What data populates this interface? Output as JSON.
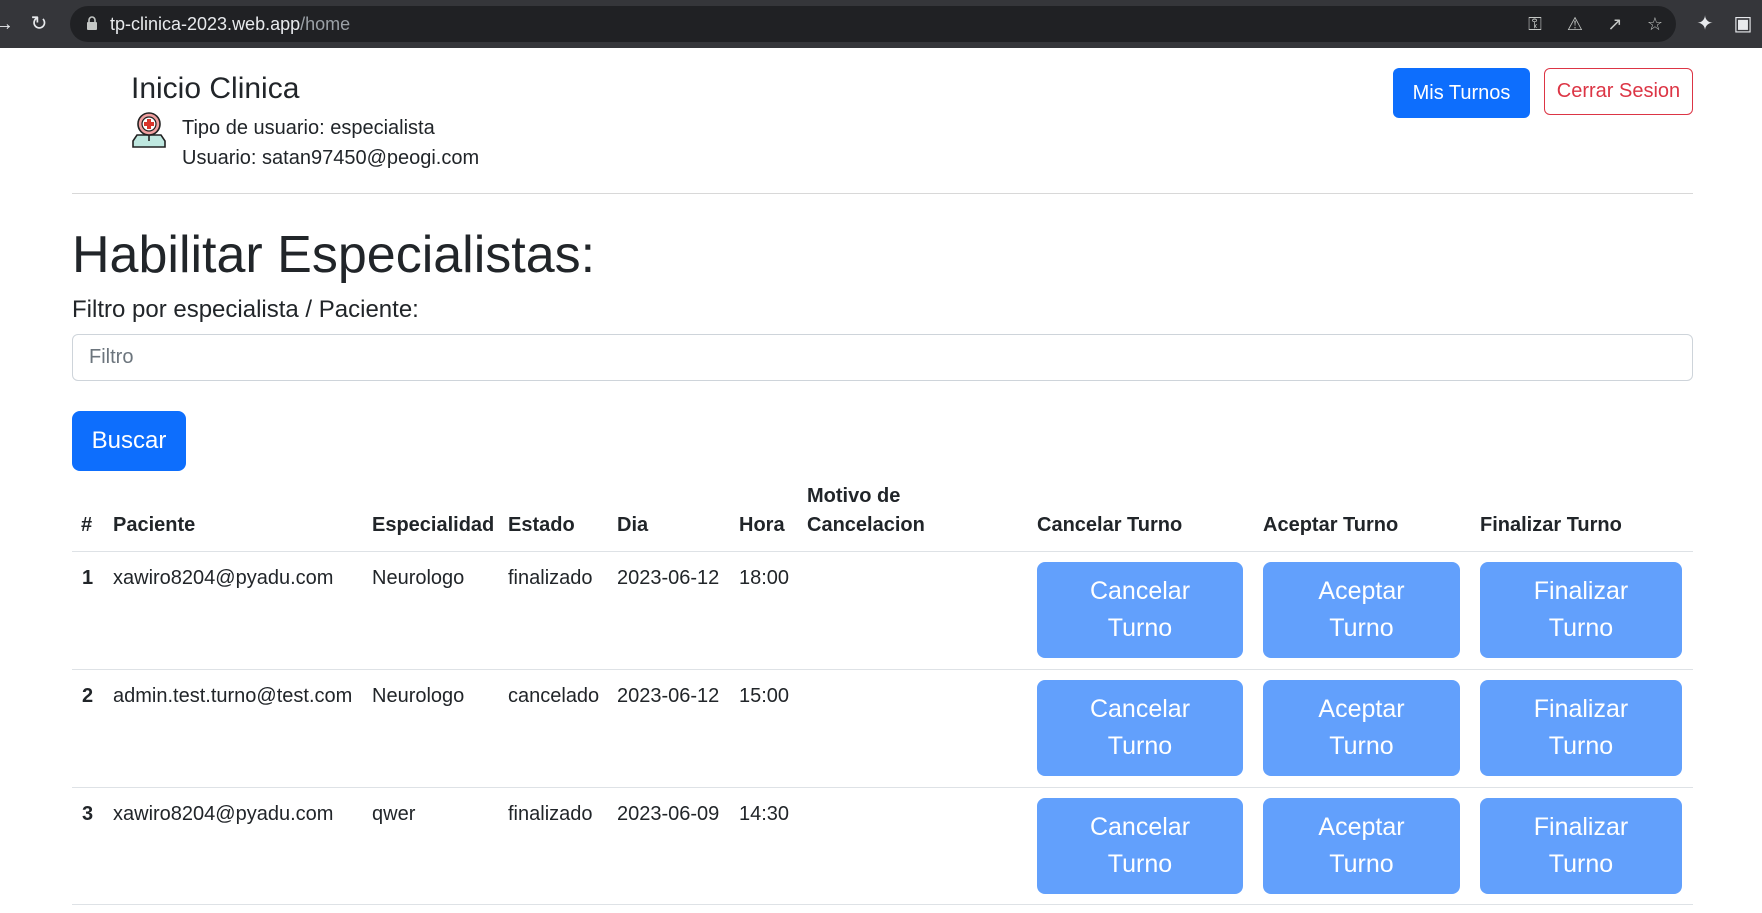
{
  "browser": {
    "url_host": "tp-clinica-2023.web.app",
    "url_path": "/home"
  },
  "header": {
    "title": "Inicio Clinica",
    "user_type": "Tipo de usuario: especialista",
    "user_email": "Usuario: satan97450@peogi.com",
    "mis_turnos_label": "Mis Turnos",
    "cerrar_sesion_label": "Cerrar Sesion"
  },
  "page": {
    "title": "Habilitar Especialistas:",
    "filter_label": "Filtro por especialista / Paciente:",
    "filter_placeholder": "Filtro",
    "filter_value": "",
    "search_label": "Buscar"
  },
  "table": {
    "columns": {
      "index": "#",
      "paciente": "Paciente",
      "especialidad": "Especialidad",
      "estado": "Estado",
      "dia": "Dia",
      "hora": "Hora",
      "motivo_line1": "Motivo de",
      "motivo_line2": "Cancelacion",
      "cancelar": "Cancelar Turno",
      "aceptar": "Aceptar Turno",
      "finalizar": "Finalizar Turno"
    },
    "rows": [
      {
        "index": "1",
        "paciente": "xawiro8204@pyadu.com",
        "especialidad": "Neurologo",
        "estado": "finalizado",
        "dia": "2023-06-12",
        "hora": "18:00",
        "motivo": "",
        "cancelar_1": "Cancelar",
        "cancelar_2": "Turno",
        "aceptar_1": "Aceptar",
        "aceptar_2": "Turno",
        "finalizar_1": "Finalizar",
        "finalizar_2": "Turno"
      },
      {
        "index": "2",
        "paciente": "admin.test.turno@test.com",
        "especialidad": "Neurologo",
        "estado": "cancelado",
        "dia": "2023-06-12",
        "hora": "15:00",
        "motivo": "",
        "cancelar_1": "Cancelar",
        "cancelar_2": "Turno",
        "aceptar_1": "Aceptar",
        "aceptar_2": "Turno",
        "finalizar_1": "Finalizar",
        "finalizar_2": "Turno"
      },
      {
        "index": "3",
        "paciente": "xawiro8204@pyadu.com",
        "especialidad": "qwer",
        "estado": "finalizado",
        "dia": "2023-06-09",
        "hora": "14:30",
        "motivo": "",
        "cancelar_1": "Cancelar",
        "cancelar_2": "Turno",
        "aceptar_1": "Aceptar",
        "aceptar_2": "Turno",
        "finalizar_1": "Finalizar",
        "finalizar_2": "Turno"
      }
    ]
  },
  "colors": {
    "primary": "#0d6efd",
    "primary_disabled": "#62a0fc",
    "danger": "#dc3545"
  }
}
